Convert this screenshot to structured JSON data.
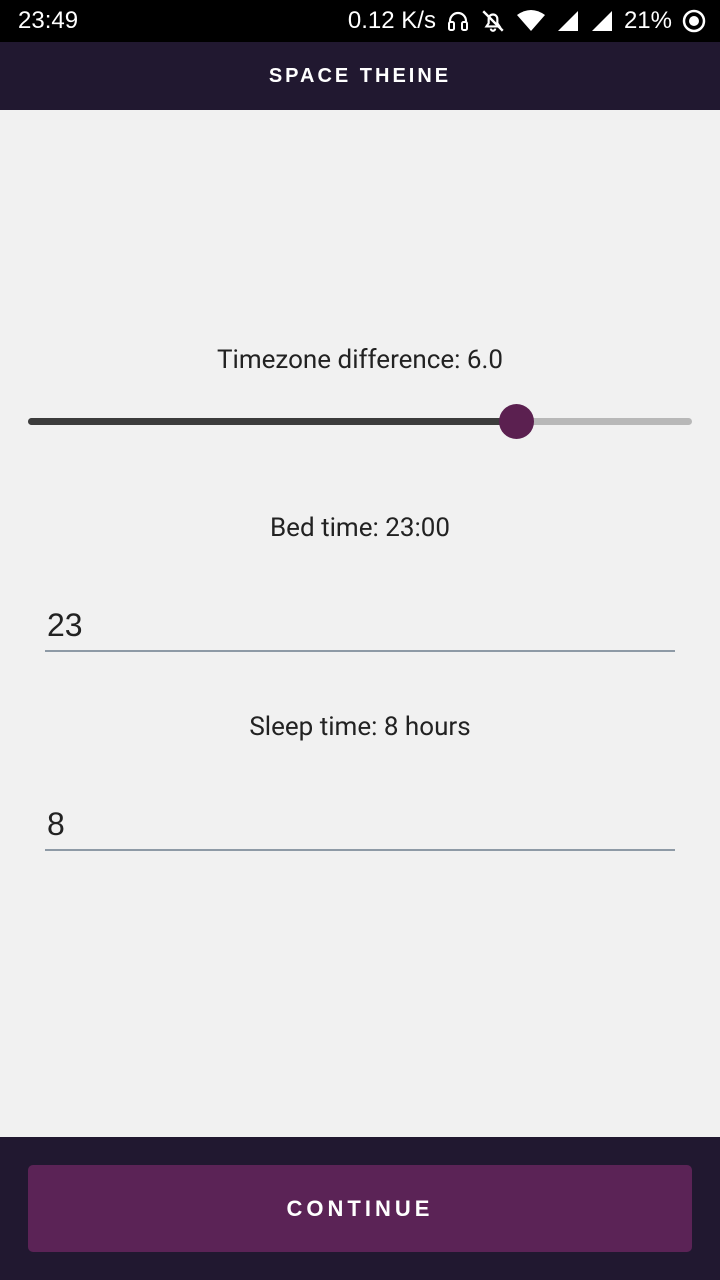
{
  "status_bar": {
    "time": "23:49",
    "network_speed": "0.12 K/s",
    "battery": "21%",
    "icons": [
      "headphones-icon",
      "mute-icon",
      "wifi-icon",
      "signal-icon",
      "signal-icon-2",
      "sync-icon"
    ]
  },
  "app_bar": {
    "title": "SPACE THEINE"
  },
  "timezone": {
    "label": "Timezone difference: 6.0",
    "slider_value": 6.0,
    "slider_fraction": 0.735
  },
  "bed_time": {
    "label": "Bed time: 23:00",
    "input_value": "23"
  },
  "sleep_time": {
    "label": "Sleep time: 8 hours",
    "input_value": "8"
  },
  "actions": {
    "continue_label": "CONTINUE"
  },
  "colors": {
    "app_bar": "#211830",
    "accent": "#5b2356",
    "thumb": "#5b2050",
    "background": "#f1f1f1"
  }
}
